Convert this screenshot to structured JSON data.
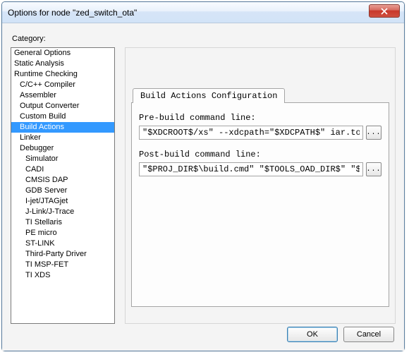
{
  "window": {
    "title": "Options for node \"zed_switch_ota\""
  },
  "category_label": "Category:",
  "categories": [
    {
      "label": "General Options",
      "level": 0,
      "selected": false
    },
    {
      "label": "Static Analysis",
      "level": 0,
      "selected": false
    },
    {
      "label": "Runtime Checking",
      "level": 0,
      "selected": false
    },
    {
      "label": "C/C++ Compiler",
      "level": 1,
      "selected": false
    },
    {
      "label": "Assembler",
      "level": 1,
      "selected": false
    },
    {
      "label": "Output Converter",
      "level": 1,
      "selected": false
    },
    {
      "label": "Custom Build",
      "level": 1,
      "selected": false
    },
    {
      "label": "Build Actions",
      "level": 1,
      "selected": true
    },
    {
      "label": "Linker",
      "level": 1,
      "selected": false
    },
    {
      "label": "Debugger",
      "level": 1,
      "selected": false
    },
    {
      "label": "Simulator",
      "level": 2,
      "selected": false
    },
    {
      "label": "CADI",
      "level": 2,
      "selected": false
    },
    {
      "label": "CMSIS DAP",
      "level": 2,
      "selected": false
    },
    {
      "label": "GDB Server",
      "level": 2,
      "selected": false
    },
    {
      "label": "I-jet/JTAGjet",
      "level": 2,
      "selected": false
    },
    {
      "label": "J-Link/J-Trace",
      "level": 2,
      "selected": false
    },
    {
      "label": "TI Stellaris",
      "level": 2,
      "selected": false
    },
    {
      "label": "PE micro",
      "level": 2,
      "selected": false
    },
    {
      "label": "ST-LINK",
      "level": 2,
      "selected": false
    },
    {
      "label": "Third-Party Driver",
      "level": 2,
      "selected": false
    },
    {
      "label": "TI MSP-FET",
      "level": 2,
      "selected": false
    },
    {
      "label": "TI XDS",
      "level": 2,
      "selected": false
    }
  ],
  "tab": {
    "label": "Build Actions Configuration"
  },
  "fields": {
    "prebuild_label": "Pre-build command line:",
    "prebuild_value": "\"$XDCROOT$/xs\" --xdcpath=\"$XDCPATH$\" iar.tools.configuro",
    "postbuild_label": "Post-build command line:",
    "postbuild_value": "\"$PROJ_DIR$\\build.cmd\" \"$TOOLS_OAD_DIR$\" \"$PROJ_DIR$\" \"..."
  },
  "browse_label": "...",
  "buttons": {
    "ok": "OK",
    "cancel": "Cancel"
  }
}
